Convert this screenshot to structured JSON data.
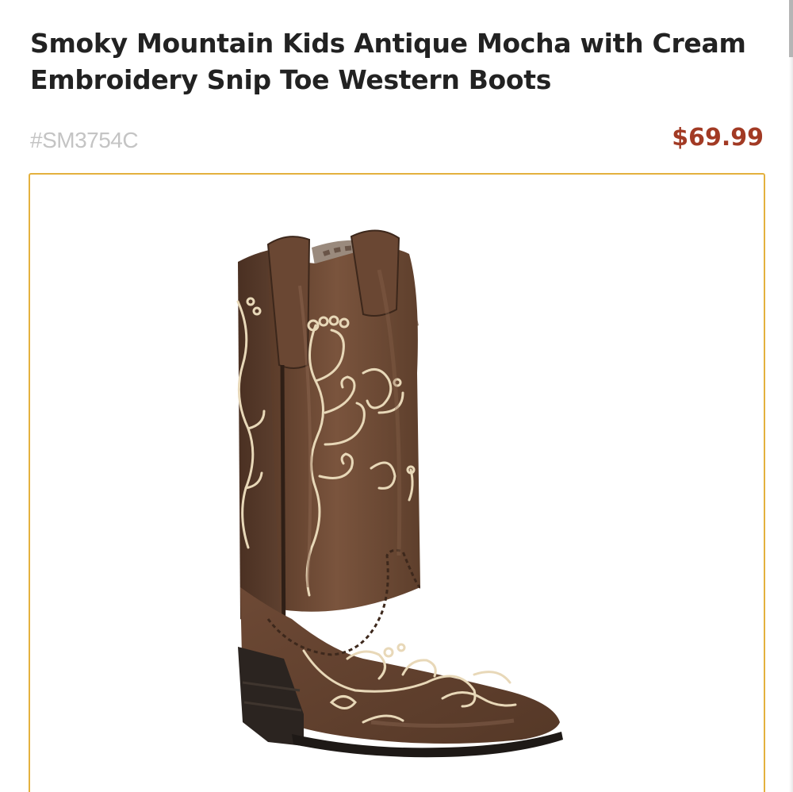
{
  "product": {
    "title": "Smoky Mountain Kids Antique Mocha with Cream Embroidery Snip Toe Western Boots",
    "sku": "#SM3754C",
    "price": "$69.99",
    "image": {
      "subject": "boot-image",
      "frame_color": "#e4b13e"
    }
  },
  "colors": {
    "price": "#a23a24",
    "title": "#222222",
    "sku": "#c4c4c4",
    "leather": "#6e4a35",
    "embroidery": "#e8d8b8",
    "sole": "#2b2420"
  }
}
